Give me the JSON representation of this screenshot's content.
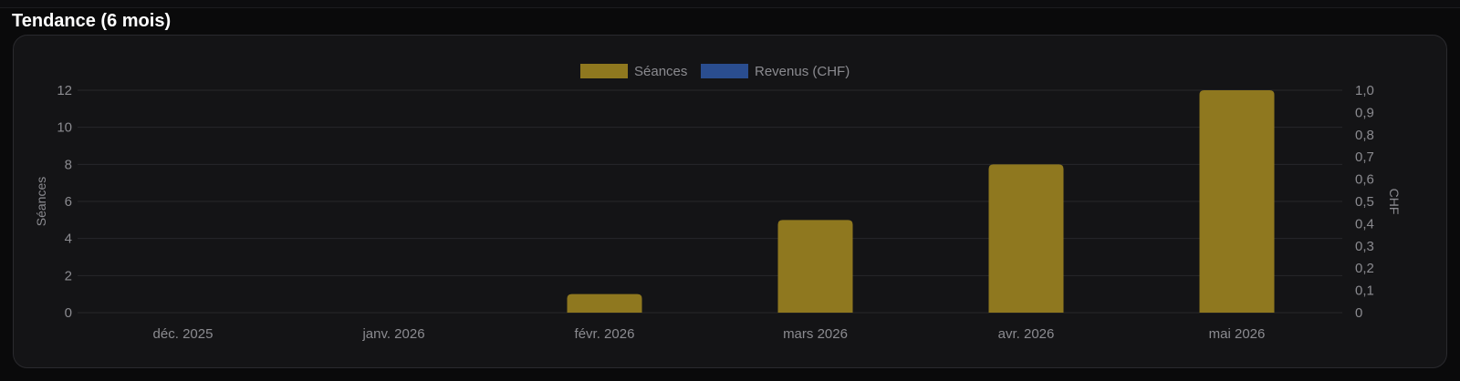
{
  "section": {
    "title": "Tendance (6 mois)"
  },
  "chart_data": {
    "type": "bar",
    "categories": [
      "déc. 2025",
      "janv. 2026",
      "févr. 2026",
      "mars 2026",
      "avr. 2026",
      "mai 2026"
    ],
    "series": [
      {
        "name": "Séances",
        "axis": "left",
        "color": "#8f781f",
        "values": [
          0,
          0,
          1,
          5,
          8,
          12
        ]
      },
      {
        "name": "Revenus (CHF)",
        "axis": "right",
        "color": "#2a4d8f",
        "values": [
          0,
          0,
          0,
          0,
          0,
          0
        ]
      }
    ],
    "y_left": {
      "label": "Séances",
      "ylim": [
        0,
        12
      ],
      "ticks": [
        "0",
        "2",
        "4",
        "6",
        "8",
        "10",
        "12"
      ]
    },
    "y_right": {
      "label": "CHF",
      "ylim": [
        0,
        1
      ],
      "ticks": [
        "0",
        "0,1",
        "0,2",
        "0,3",
        "0,4",
        "0,5",
        "0,6",
        "0,7",
        "0,8",
        "0,9",
        "1,0"
      ]
    },
    "grid": true,
    "legend_position": "top-center",
    "colors": {
      "grid": "#27272b",
      "text": "#8b8b90",
      "background": "#141416"
    }
  }
}
